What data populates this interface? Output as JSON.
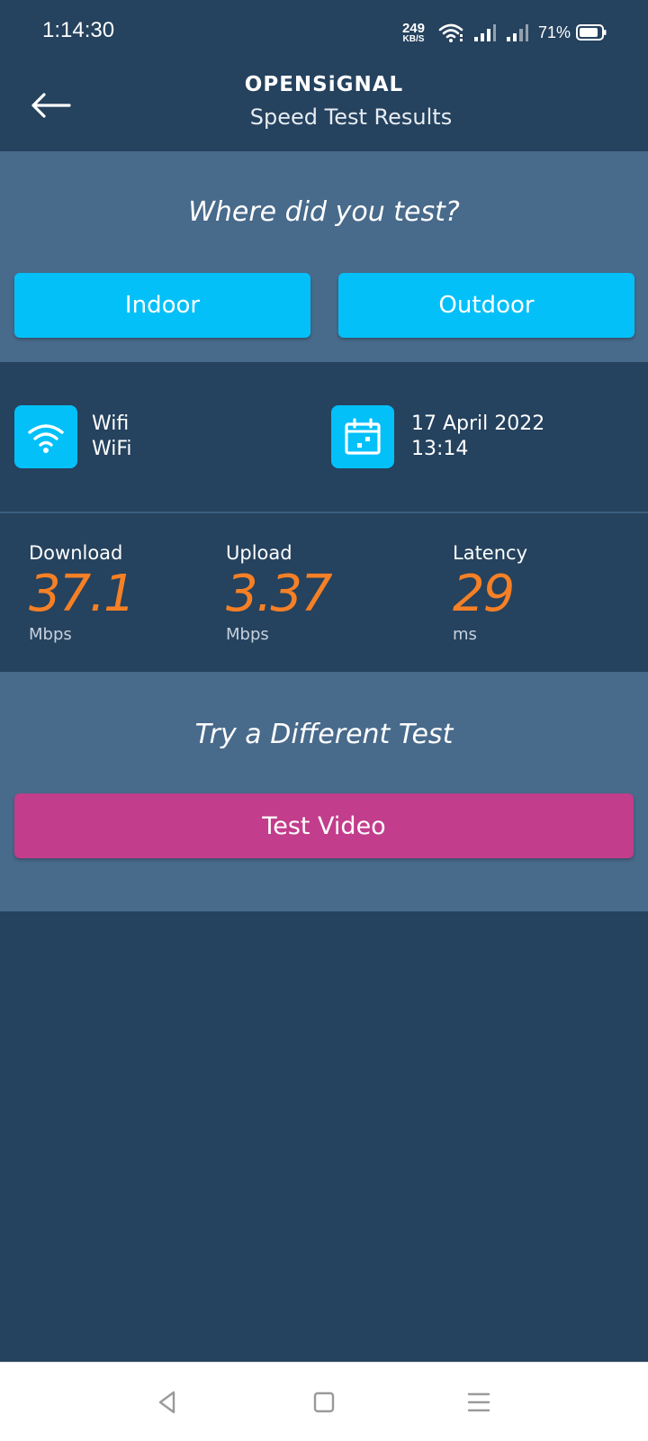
{
  "status_bar": {
    "time": "1:14:30",
    "net_speed_value": "249",
    "net_speed_unit": "KB/S",
    "battery": "71%"
  },
  "header": {
    "brand": "OPENSiGNAL",
    "subtitle": "Speed Test Results"
  },
  "location": {
    "question": "Where did you test?",
    "indoor_label": "Indoor",
    "outdoor_label": "Outdoor"
  },
  "connection": {
    "type": "Wifi",
    "name": "WiFi",
    "date": "17 April 2022",
    "time": "13:14"
  },
  "results": {
    "download": {
      "label": "Download",
      "value": "37.1",
      "unit": "Mbps"
    },
    "upload": {
      "label": "Upload",
      "value": "3.37",
      "unit": "Mbps"
    },
    "latency": {
      "label": "Latency",
      "value": "29",
      "unit": "ms"
    }
  },
  "other_tests": {
    "title": "Try a Different Test",
    "video_button": "Test Video"
  },
  "colors": {
    "background": "#25425e",
    "panel": "#486a8b",
    "accent_blue": "#03c0f9",
    "accent_orange": "#f58025",
    "video_pink": "#c23d8b"
  },
  "icons": {
    "back": "arrow-left-icon",
    "wifi": "wifi-icon",
    "calendar": "calendar-icon"
  }
}
